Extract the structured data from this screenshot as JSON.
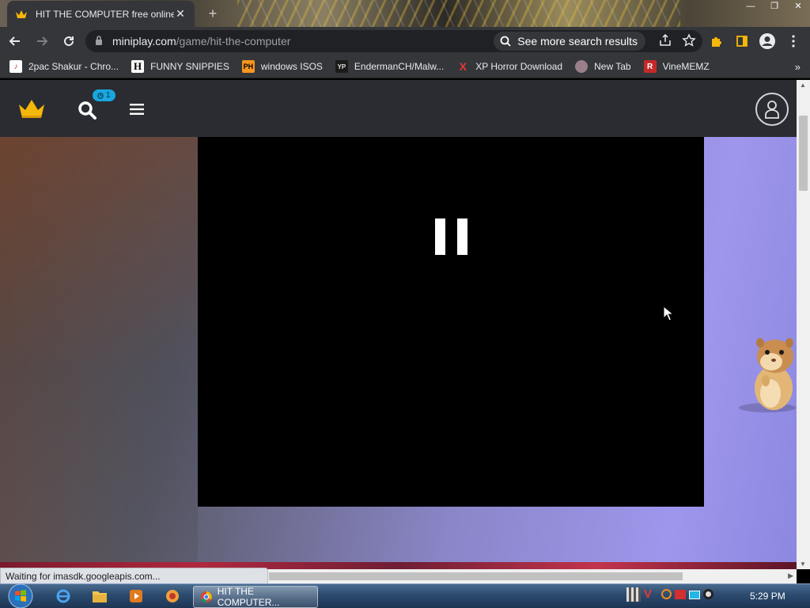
{
  "browser": {
    "tab": {
      "title": "HIT THE COMPUTER free online"
    },
    "url": {
      "host": "miniplay.com",
      "path": "/game/hit-the-computer"
    },
    "search_chip": "See more search results",
    "bookmarks": [
      {
        "label": "2pac Shakur - Chro...",
        "icon": "G"
      },
      {
        "label": "FUNNY SNIPPIES",
        "icon": "H"
      },
      {
        "label": "windows ISOS",
        "icon": "PH"
      },
      {
        "label": "EndermanCH/Malw...",
        "icon": "YP"
      },
      {
        "label": "XP Horror Download",
        "icon": "X"
      },
      {
        "label": "New Tab",
        "icon": "tab"
      },
      {
        "label": "VineMEMZ",
        "icon": "R"
      }
    ],
    "bookmarks_more": "»",
    "status_text": "Waiting for imasdk.googleapis.com..."
  },
  "site": {
    "notification_count": "1"
  },
  "taskbar": {
    "active_task": "HIT THE COMPUTER...",
    "clock": "5:29 PM"
  },
  "colors": {
    "browser_chrome": "#35363a",
    "omnibox": "#202124",
    "site_header": "#2b2c31",
    "crown": "#f5b70a",
    "badge": "#18a7e0"
  }
}
